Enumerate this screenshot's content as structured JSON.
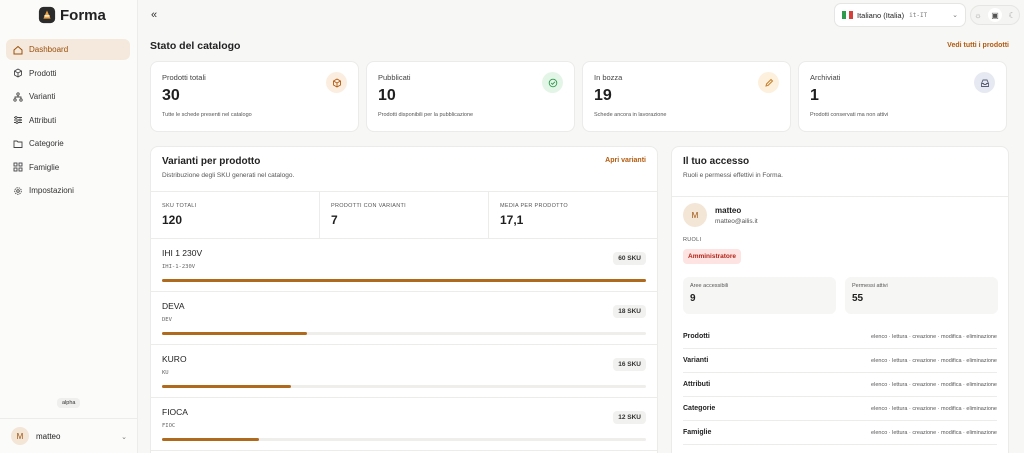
{
  "app": {
    "name": "Forma",
    "badge": "alpha"
  },
  "colors": {
    "accent": "#b25a0e",
    "accent_bg": "#f4e9dc",
    "bar": "#b06a1e",
    "role_bg": "#fde3e1",
    "role_fg": "#b42318"
  },
  "sidebar": {
    "items": [
      {
        "label": "Dashboard",
        "icon": "home-icon"
      },
      {
        "label": "Prodotti",
        "icon": "box-icon"
      },
      {
        "label": "Varianti",
        "icon": "hierarchy-icon"
      },
      {
        "label": "Attributi",
        "icon": "sliders-icon"
      },
      {
        "label": "Categorie",
        "icon": "folder-icon"
      },
      {
        "label": "Famiglie",
        "icon": "grid-icon"
      },
      {
        "label": "Impostazioni",
        "icon": "gear-icon"
      }
    ],
    "user": {
      "initial": "M",
      "name": "matteo"
    }
  },
  "header": {
    "language": {
      "label": "Italiano (Italia)",
      "code": "it-IT"
    },
    "theme_icons": [
      "sun-icon",
      "monitor-icon",
      "moon-icon"
    ]
  },
  "catalog": {
    "title": "Stato del catalogo",
    "see_all": "Vedi tutti i prodotti",
    "stats": [
      {
        "label": "Prodotti totali",
        "value": "30",
        "desc": "Tutte le schede presenti nel catalogo",
        "icon": "cube-icon"
      },
      {
        "label": "Pubblicati",
        "value": "10",
        "desc": "Prodotti disponibili per la pubblicazione",
        "icon": "check-circle-icon"
      },
      {
        "label": "In bozza",
        "value": "19",
        "desc": "Schede ancora in lavorazione",
        "icon": "pencil-icon"
      },
      {
        "label": "Archiviati",
        "value": "1",
        "desc": "Prodotti conservati ma non attivi",
        "icon": "inbox-icon"
      }
    ]
  },
  "variants": {
    "title": "Varianti per prodotto",
    "subtitle": "Distribuzione degli SKU generati nel catalogo.",
    "link": "Apri varianti",
    "metrics": [
      {
        "label": "SKU TOTALI",
        "value": "120"
      },
      {
        "label": "PRODOTTI CON VARIANTI",
        "value": "7"
      },
      {
        "label": "MEDIA PER PRODOTTO",
        "value": "17,1"
      }
    ],
    "products": [
      {
        "name": "IHI 1 230V",
        "code": "IHI-1-230V",
        "sku": "60 SKU",
        "share": 1.0
      },
      {
        "name": "DEVA",
        "code": "DEV",
        "sku": "18 SKU",
        "share": 0.3
      },
      {
        "name": "KURO",
        "code": "KU",
        "sku": "16 SKU",
        "share": 0.267
      },
      {
        "name": "FIOCA",
        "code": "FIOC",
        "sku": "12 SKU",
        "share": 0.2
      }
    ]
  },
  "access": {
    "title": "Il tuo accesso",
    "subtitle": "Ruoli e permessi effettivi in Forma.",
    "user": {
      "initial": "M",
      "name": "matteo",
      "email": "matteo@ailis.it"
    },
    "roles_label": "RUOLI",
    "role": "Amministratore",
    "areas": {
      "label": "Aree accessibili",
      "value": "9"
    },
    "perms": {
      "label": "Permessi attivi",
      "value": "55"
    },
    "permissions": [
      {
        "area": "Prodotti",
        "actions": "elenco · lettura · creazione · modifica · eliminazione"
      },
      {
        "area": "Varianti",
        "actions": "elenco · lettura · creazione · modifica · eliminazione"
      },
      {
        "area": "Attributi",
        "actions": "elenco · lettura · creazione · modifica · eliminazione"
      },
      {
        "area": "Categorie",
        "actions": "elenco · lettura · creazione · modifica · eliminazione"
      },
      {
        "area": "Famiglie",
        "actions": "elenco · lettura · creazione · modifica · eliminazione"
      }
    ]
  }
}
